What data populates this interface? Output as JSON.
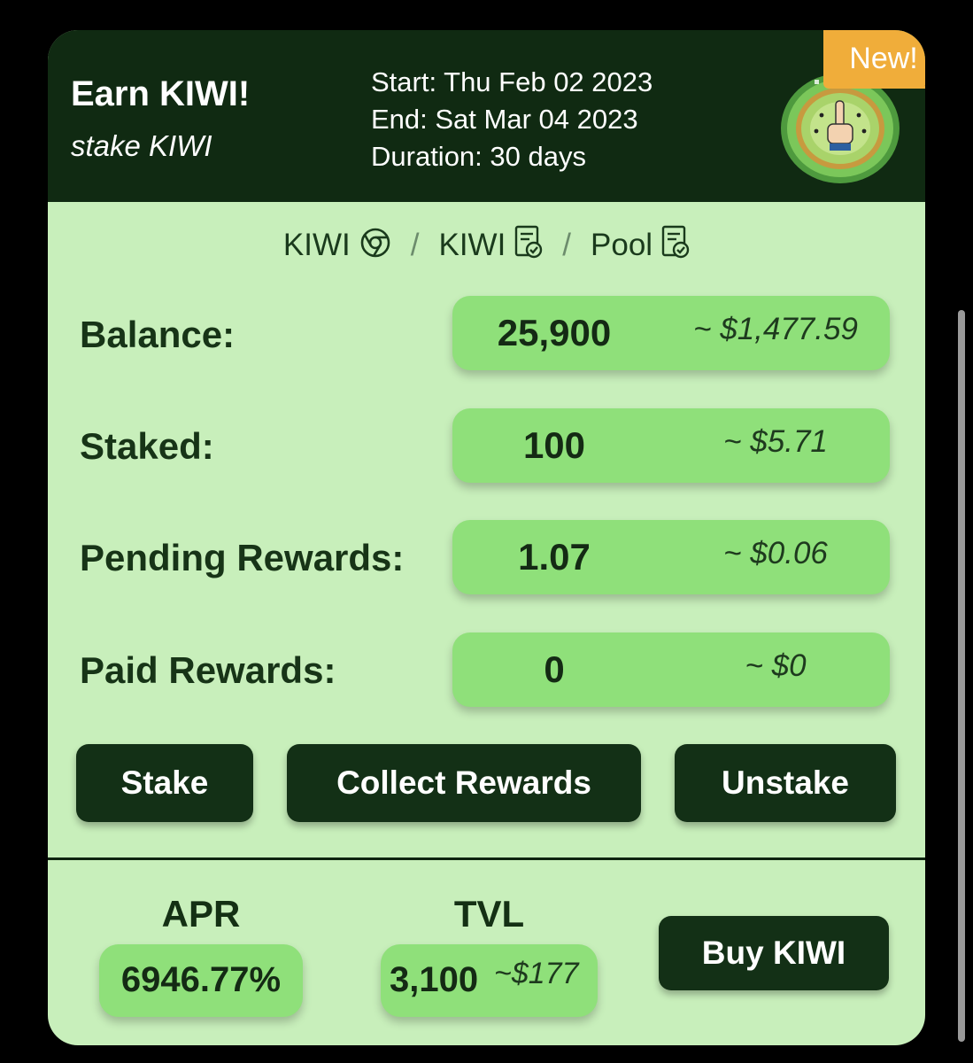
{
  "header": {
    "title": "Earn KIWI!",
    "subtitle": "stake KIWI",
    "start": "Start: Thu Feb 02 2023",
    "end": "End: Sat Mar 04 2023",
    "duration": "Duration: 30 days",
    "badge": "New!"
  },
  "breadcrumb": {
    "token": "KIWI",
    "contract": "KIWI",
    "pool": "Pool",
    "separator": "/"
  },
  "rows": [
    {
      "label": "Balance:",
      "amount": "25,900",
      "usd": "~ $1,477.59"
    },
    {
      "label": "Staked:",
      "amount": "100",
      "usd": "~ $5.71"
    },
    {
      "label": "Pending Rewards:",
      "amount": "1.07",
      "usd": "~ $0.06"
    },
    {
      "label": "Paid Rewards:",
      "amount": "0",
      "usd": "~ $0"
    }
  ],
  "buttons": {
    "stake": "Stake",
    "collect": "Collect Rewards",
    "unstake": "Unstake",
    "buy": "Buy KIWI"
  },
  "stats": {
    "apr_label": "APR",
    "apr_value": "6946.77%",
    "tvl_label": "TVL",
    "tvl_value": "3,100",
    "tvl_usd": "~$177"
  },
  "colors": {
    "header_bg": "#102a12",
    "card_bg": "#c8efbb",
    "value_bg": "#8fe07a",
    "badge": "#f0ad3a"
  },
  "icons": {
    "token": "chrome-icon",
    "contract": "contract-verified-icon",
    "pool": "contract-verified-icon",
    "badge": "kiwi-coin-icon"
  }
}
